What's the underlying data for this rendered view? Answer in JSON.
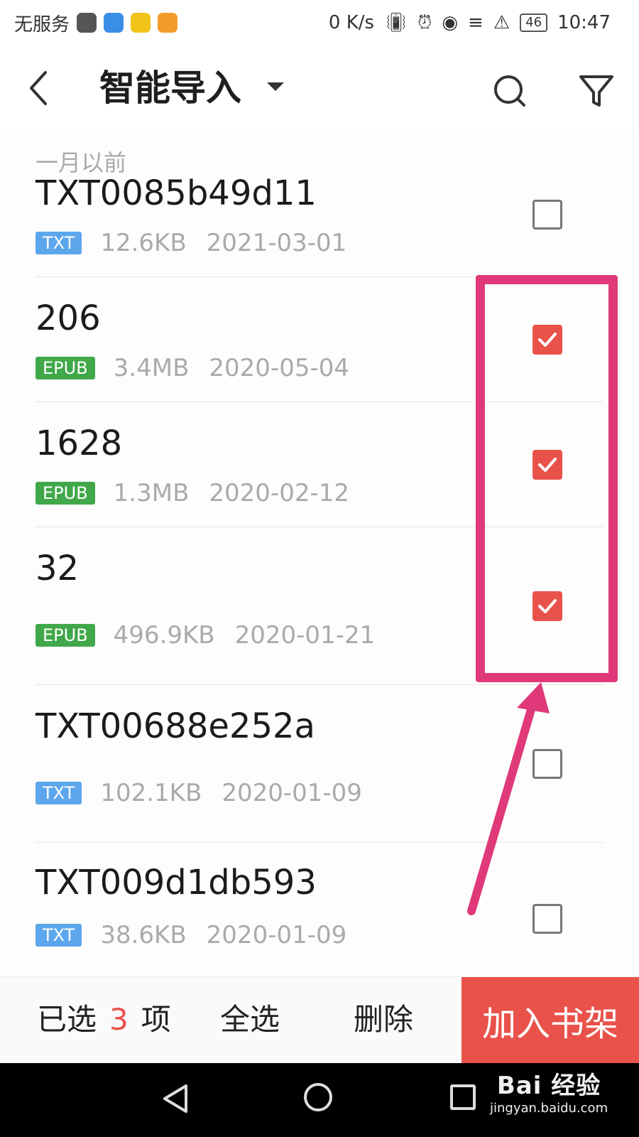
{
  "status_bar": {
    "carrier": "无服务",
    "net_speed": "0 K/s",
    "battery": "46",
    "time": "10:47",
    "app_icon_colors": [
      "#555555",
      "#3a8ee6",
      "#f0c419",
      "#f39b2b"
    ]
  },
  "header": {
    "title": "智能导入"
  },
  "list": {
    "section_label": "一月以前",
    "items": [
      {
        "name": "TXT0085b49d11",
        "type": "TXT",
        "size": "12.6KB",
        "date": "2021-03-01",
        "checked": false
      },
      {
        "name": "206",
        "type": "EPUB",
        "size": "3.4MB",
        "date": "2020-05-04",
        "checked": true
      },
      {
        "name": "1628",
        "type": "EPUB",
        "size": "1.3MB",
        "date": "2020-02-12",
        "checked": true
      },
      {
        "name": "32",
        "type": "EPUB",
        "size": "496.9KB",
        "date": "2020-01-21",
        "checked": true
      },
      {
        "name": "TXT00688e252a",
        "type": "TXT",
        "size": "102.1KB",
        "date": "2020-01-09",
        "checked": false
      },
      {
        "name": "TXT009d1db593",
        "type": "TXT",
        "size": "38.6KB",
        "date": "2020-01-09",
        "checked": false
      }
    ]
  },
  "footer": {
    "selected_prefix": "已选",
    "selected_count": "3",
    "selected_suffix": "项",
    "select_all": "全选",
    "delete": "删除",
    "add_to_shelf": "加入书架"
  },
  "colors": {
    "accent": "#e9524a",
    "highlight": "#e0397a",
    "txt_badge": "#5ca6ec",
    "epub_badge": "#40a84a"
  },
  "watermark": {
    "line1": "Bai 经验",
    "line2": "jingyan.baidu.com"
  }
}
